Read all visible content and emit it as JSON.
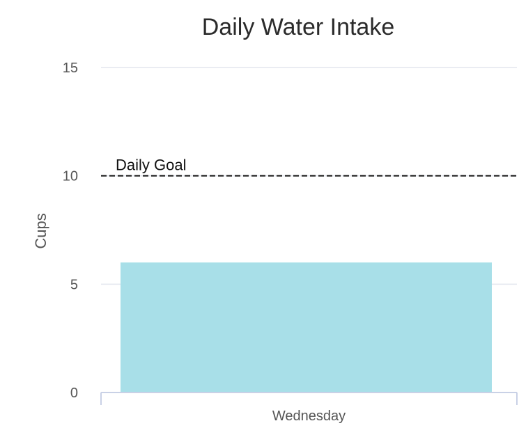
{
  "chart_data": {
    "type": "bar",
    "title": "Daily Water Intake",
    "xlabel": "",
    "ylabel": "Cups",
    "categories": [
      "Wednesday"
    ],
    "values": [
      6
    ],
    "ylim": [
      0,
      15
    ],
    "yticks": [
      0,
      5,
      10,
      15
    ],
    "grid": true,
    "legend": "none",
    "bar_color": "#a8dfe8",
    "reference_line": {
      "value": 10,
      "label": "Daily Goal",
      "style": "dashed",
      "color": "#111111"
    }
  }
}
